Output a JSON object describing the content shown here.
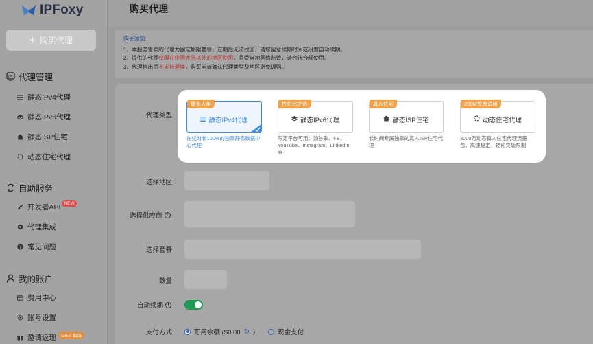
{
  "app": {
    "logo_text": "IPFoxy"
  },
  "sidebar": {
    "buy_button": "购买代理",
    "sections": [
      {
        "title": "代理管理",
        "icon": "proxy-manage-icon"
      },
      {
        "title": "自助服务",
        "icon": "self-service-icon"
      },
      {
        "title": "我的账户",
        "icon": "user-icon"
      }
    ],
    "items": [
      {
        "label": "静态IPv4代理",
        "icon": "list-icon"
      },
      {
        "label": "静态IPv6代理",
        "icon": "stack-icon"
      },
      {
        "label": "静态ISP住宅",
        "icon": "house-icon"
      },
      {
        "label": "动态住宅代理",
        "icon": "spinner-icon"
      },
      {
        "label": "开发者API",
        "icon": "api-icon",
        "badge": "NEW"
      },
      {
        "label": "代理集成",
        "icon": "puzzle-icon"
      },
      {
        "label": "常见问题",
        "icon": "question-icon"
      },
      {
        "label": "费用中心",
        "icon": "card-icon"
      },
      {
        "label": "账号设置",
        "icon": "gear-icon"
      },
      {
        "label": "邀请返现",
        "icon": "gift-icon",
        "badge": "GET $$$"
      }
    ]
  },
  "header": {
    "title": "购买代理"
  },
  "notice": {
    "title": "购买须知:",
    "line1": "1、本服务售卖的代理为固定期限套餐，过期后无法找回，请您留意续期时间或设置自动续期。",
    "line2_a": "2、提供的代理",
    "line2_red": "仅限在中国大陆以外的地区使用",
    "line2_b": "，且受当地网络监管，请合法合规使用。",
    "line3_a": "3、代理售出后",
    "line3_red": "不支持退换",
    "line3_b": "，购买前请确认代理类型及地区避免误购。"
  },
  "form": {
    "proxy_type_label": "代理类型",
    "region_label": "选择地区",
    "supplier_label": "选择供应商",
    "package_label": "选择套餐",
    "quantity_label": "数量",
    "auto_renew_label": "自动续期",
    "auto_renew_on": true,
    "payment_label": "支付方式",
    "payment_balance": "可用余额 ($0.00",
    "payment_balance_close": ")",
    "payment_cash": "现金支付",
    "payment_selected": "balance"
  },
  "proxy_types": [
    {
      "tag": "最多人用",
      "name": "静态IPv4代理",
      "icon": "list-icon",
      "desc": "在线时长100%的独享静态数据中心代理",
      "selected": true
    },
    {
      "tag": "性价比之选",
      "name": "静态IPv6代理",
      "icon": "stack-icon",
      "desc": "限定平台可用：如谷歌、FB、YouTube、Instagram、LinkedIn等",
      "selected": false
    },
    {
      "tag": "真人住宅",
      "name": "静态ISP住宅",
      "icon": "house-icon",
      "desc": "长时间专属独享的真人ISP住宅代理",
      "selected": false
    },
    {
      "tag": "200M免费试用",
      "name": "动态住宅代理",
      "icon": "spinner-icon",
      "desc": "3000万动态真人住宅代理流量包，高速稳定，轻松突破限制",
      "selected": false
    }
  ],
  "colors": {
    "accent": "#3f8ce6",
    "tag": "#f0a34a",
    "toggle": "#1e9b55",
    "danger": "#e04a4a"
  }
}
